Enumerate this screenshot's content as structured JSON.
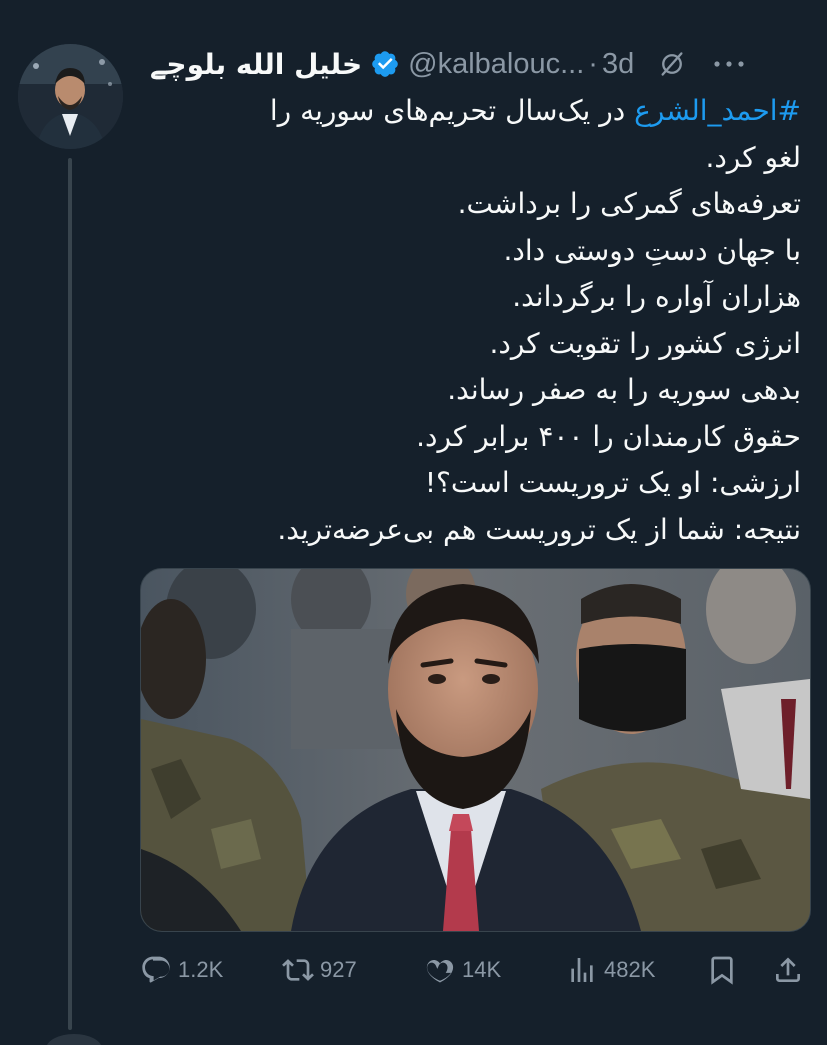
{
  "header": {
    "display_name": "خلیل الله بلوچے",
    "handle": "@kalbalouc...",
    "separator": "·",
    "time": "3d"
  },
  "tweet": {
    "hashtag": "#احمد_الشرع",
    "line1_rest": " در یک‌سال تحریم‌های سوریه را",
    "line2": "لغو کرد.",
    "line3": "تعرفه‌های گمرکی را برداشت.",
    "line4": "با جهان دستِ دوستی داد.",
    "line5": "هزاران آواره را برگرداند.",
    "line6": "انرژی کشور را تقویت کرد.",
    "line7": "بدهی سوریه را به صفر رساند.",
    "line8": "حقوق کارمندان را ۴۰۰ برابر کرد.",
    "line9": "ارزشی: او یک تروریست است؟!",
    "line10": "نتیجه: شما از یک تروریست هم بی‌عرضه‌ترید."
  },
  "actions": {
    "replies": "1.2K",
    "retweets": "927",
    "likes": "14K",
    "views": "482K"
  },
  "icons": {
    "verified": "verified-badge-icon",
    "grok": "grok-icon",
    "more": "more-icon",
    "reply": "reply-icon",
    "retweet": "retweet-icon",
    "like": "heart-icon",
    "views": "views-icon",
    "bookmark": "bookmark-icon",
    "share": "share-icon"
  },
  "colors": {
    "background": "#15202b",
    "text": "#f7f9f9",
    "muted": "#8b98a5",
    "accent": "#1d9bf0"
  }
}
